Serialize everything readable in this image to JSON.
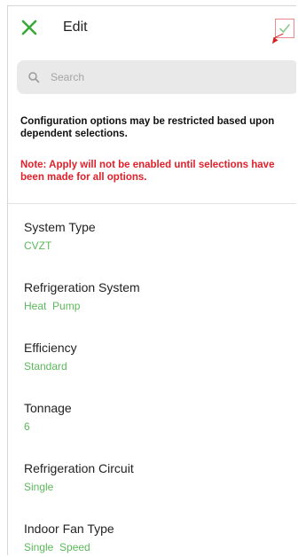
{
  "header": {
    "title": "Edit"
  },
  "search": {
    "placeholder": "Search"
  },
  "notices": {
    "info": "Configuration options may be restricted based upon dependent selections.",
    "warning": "Note: Apply will not be enabled until selections have been made for all options."
  },
  "options": [
    {
      "label": "System Type",
      "value": "CVZT"
    },
    {
      "label": "Refrigeration System",
      "value": "Heat  Pump"
    },
    {
      "label": "Efficiency",
      "value": "Standard"
    },
    {
      "label": "Tonnage",
      "value": "6"
    },
    {
      "label": "Refrigeration Circuit",
      "value": "Single"
    },
    {
      "label": "Indoor Fan Type",
      "value": "Single  Speed"
    }
  ],
  "colors": {
    "accent_green": "#5cb85c",
    "close_green": "#3aa83a",
    "warning_red": "#e0202a",
    "search_bg": "#e9e9e9"
  },
  "icons": {
    "close": "close-icon",
    "apply": "check-icon",
    "search": "search-icon"
  }
}
